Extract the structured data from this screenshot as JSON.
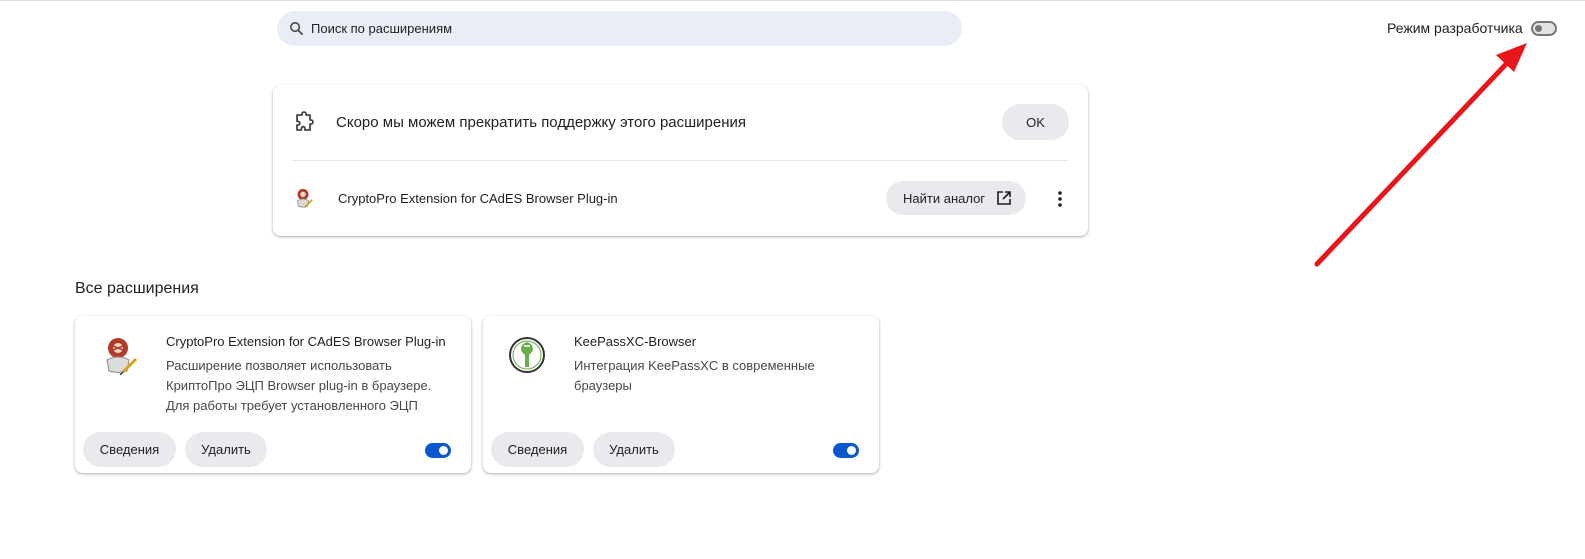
{
  "header": {
    "search_placeholder": "Поиск по расширениям",
    "dev_mode_label": "Режим разработчика",
    "dev_mode_enabled": false
  },
  "warning": {
    "title": "Скоро мы можем прекратить поддержку этого расширения",
    "ok_label": "OK",
    "extension_name": "CryptoPro Extension for CAdES Browser Plug-in",
    "find_alternative_label": "Найти аналог"
  },
  "all_extensions": {
    "title": "Все расширения",
    "items": [
      {
        "name": "CryptoPro Extension for CAdES Browser Plug-in",
        "description": "Расширение позволяет использовать КриптоПро ЭЦП Browser plug-in в браузере. Для работы требует установленного ЭЦП",
        "details_label": "Сведения",
        "remove_label": "Удалить",
        "enabled": true,
        "icon": "cryptopro-icon"
      },
      {
        "name": "KeePassXC-Browser",
        "description": "Интеграция KeePassXC в современные браузеры",
        "details_label": "Сведения",
        "remove_label": "Удалить",
        "enabled": true,
        "icon": "keepassxc-icon"
      }
    ]
  },
  "colors": {
    "accent": "#0b57d0",
    "annotation_arrow": "#e8161b",
    "search_bg": "#e9eef6",
    "button_bg": "#e9eaed"
  }
}
